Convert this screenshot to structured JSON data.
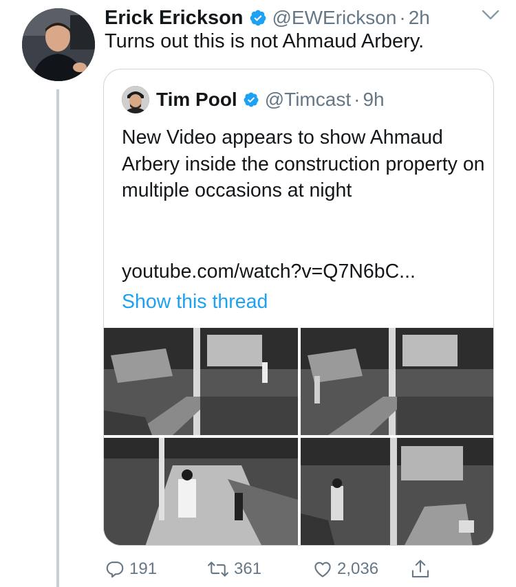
{
  "tweet": {
    "author_name": "Erick Erickson",
    "author_handle": "@EWErickson",
    "separator": "·",
    "time": "2h",
    "text": "Turns out this is not Ahmaud Arbery."
  },
  "quoted": {
    "author_name": "Tim Pool",
    "author_handle": "@Timcast",
    "separator": "·",
    "time": "9h",
    "text": "New Video appears to show Ahmaud Arbery inside the construction property on multiple occasions at night",
    "link": "youtube.com/watch?v=Q7N6bC...",
    "show_thread": "Show this thread"
  },
  "actions": {
    "replies": "191",
    "retweets": "361",
    "likes": "2,036"
  },
  "colors": {
    "link_blue": "#1da1f2",
    "verified_blue": "#1da1f2",
    "muted_gray": "#657786",
    "border": "#ccd6dd"
  },
  "icons": [
    "verified-badge-icon",
    "chevron-down-icon",
    "reply-icon",
    "retweet-icon",
    "like-icon",
    "share-icon"
  ]
}
